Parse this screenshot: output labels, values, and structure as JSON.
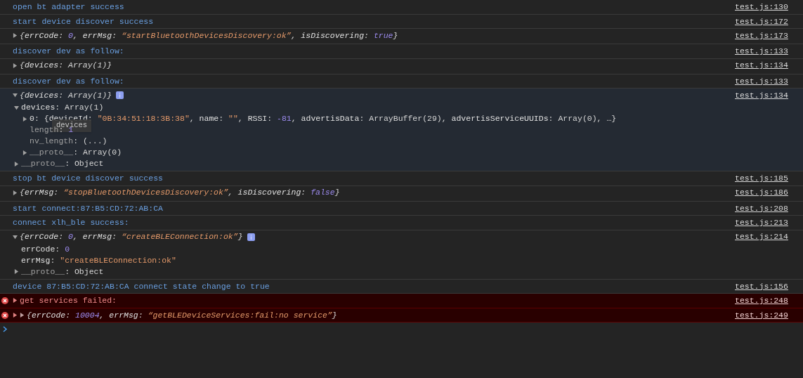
{
  "entries": [
    {
      "kind": "log",
      "text": "open bt adapter success",
      "source": "test.js:130"
    },
    {
      "kind": "log",
      "text": "start device discover success",
      "source": "test.js:172"
    },
    {
      "kind": "object",
      "expanded": false,
      "summary": [
        {
          "punct": "{"
        },
        {
          "key": "errCode"
        },
        {
          "punct": ": "
        },
        {
          "number": "0"
        },
        {
          "punct": ", "
        },
        {
          "key": "errMsg"
        },
        {
          "punct": ": "
        },
        {
          "string": "“startBluetoothDevicesDiscovery:ok”"
        },
        {
          "punct": ", "
        },
        {
          "key": "isDiscovering"
        },
        {
          "punct": ": "
        },
        {
          "number": "true"
        },
        {
          "punct": "}"
        }
      ],
      "source": "test.js:173"
    },
    {
      "kind": "log",
      "text": "discover dev as follow:",
      "source": "test.js:133"
    },
    {
      "kind": "object",
      "expanded": false,
      "summary": [
        {
          "punct": "{"
        },
        {
          "key": "devices"
        },
        {
          "punct": ": Array(1)}"
        }
      ],
      "source": "test.js:134"
    },
    {
      "kind": "log",
      "text": "discover dev as follow:",
      "source": "test.js:133"
    },
    {
      "kind": "object",
      "expanded": true,
      "summary": [
        {
          "punct": "{"
        },
        {
          "key": "devices"
        },
        {
          "punct": ": Array(1)}"
        }
      ],
      "source": "test.js:134",
      "children": [
        {
          "label": [
            {
              "key": "devices"
            },
            {
              "punct": ": Array(1)"
            }
          ],
          "expanded": true,
          "children": [
            {
              "label": [
                {
                  "key": "0"
                },
                {
                  "punct": ": {"
                },
                {
                  "key": "deviceId"
                },
                {
                  "punct": ": "
                },
                {
                  "string": "\"0B:34:51:18:3B:38\""
                },
                {
                  "punct": ", "
                },
                {
                  "key": "name"
                },
                {
                  "punct": ": "
                },
                {
                  "string": "\"\""
                },
                {
                  "punct": ", "
                },
                {
                  "key": "RSSI"
                },
                {
                  "punct": ": "
                },
                {
                  "number": "-81"
                },
                {
                  "punct": ", "
                },
                {
                  "key": "advertisData"
                },
                {
                  "punct": ": ArrayBuffer(29), "
                },
                {
                  "key": "advertisServiceUUIDs"
                },
                {
                  "punct": ": Array(0), …}"
                }
              ],
              "expanded": false,
              "tooltip": "devices"
            },
            {
              "label": [
                {
                  "dim": "length"
                },
                {
                  "punct": ": "
                },
                {
                  "number": "1"
                }
              ]
            },
            {
              "label": [
                {
                  "dim": "nv_length"
                },
                {
                  "punct": ": (...)"
                }
              ]
            },
            {
              "label": [
                {
                  "dim": "__proto__"
                },
                {
                  "punct": ": Array(0)"
                }
              ],
              "expanded": false
            }
          ]
        },
        {
          "label": [
            {
              "dim": "__proto__"
            },
            {
              "punct": ": Object"
            }
          ],
          "expanded": false
        }
      ]
    },
    {
      "kind": "log",
      "text": "stop bt device discover success",
      "source": "test.js:185"
    },
    {
      "kind": "object",
      "expanded": false,
      "summary": [
        {
          "punct": "{"
        },
        {
          "key": "errMsg"
        },
        {
          "punct": ": "
        },
        {
          "string": "“stopBluetoothDevicesDiscovery:ok”"
        },
        {
          "punct": ", "
        },
        {
          "key": "isDiscovering"
        },
        {
          "punct": ": "
        },
        {
          "number": "false"
        },
        {
          "punct": "}"
        }
      ],
      "source": "test.js:186"
    },
    {
      "kind": "log",
      "text": "start connect:87:B5:CD:72:AB:CA",
      "source": "test.js:208"
    },
    {
      "kind": "log",
      "text": "connect xlh_ble success:",
      "source": "test.js:213"
    },
    {
      "kind": "object",
      "expanded": true,
      "summary": [
        {
          "punct": "{"
        },
        {
          "key": "errCode"
        },
        {
          "punct": ": "
        },
        {
          "number": "0"
        },
        {
          "punct": ", "
        },
        {
          "key": "errMsg"
        },
        {
          "punct": ": "
        },
        {
          "string": "“createBLEConnection:ok”"
        },
        {
          "punct": "}"
        }
      ],
      "source": "test.js:214",
      "children": [
        {
          "label": [
            {
              "key": "errCode"
            },
            {
              "punct": ": "
            },
            {
              "number": "0"
            }
          ]
        },
        {
          "label": [
            {
              "key": "errMsg"
            },
            {
              "punct": ": "
            },
            {
              "string": "\"createBLEConnection:ok\""
            }
          ]
        },
        {
          "label": [
            {
              "dim": "__proto__"
            },
            {
              "punct": ": Object"
            }
          ],
          "expanded": false
        }
      ]
    },
    {
      "kind": "log",
      "text": "device 87:B5:CD:72:AB:CA connect state change to true",
      "source": "test.js:156"
    },
    {
      "kind": "error",
      "expanded": false,
      "text": "get services failed:",
      "source": "test.js:248"
    },
    {
      "kind": "error_object",
      "expanded": false,
      "summary": [
        {
          "punct": "{"
        },
        {
          "key": "errCode"
        },
        {
          "punct": ": "
        },
        {
          "number": "10004"
        },
        {
          "punct": ", "
        },
        {
          "key": "errMsg"
        },
        {
          "punct": ": "
        },
        {
          "string": "“getBLEDeviceServices:fail:no service”"
        },
        {
          "punct": "}"
        }
      ],
      "source": "test.js:249"
    }
  ]
}
